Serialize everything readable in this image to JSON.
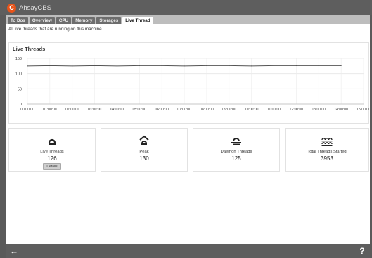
{
  "app": {
    "title": "AhsayCBS",
    "logo_letter": "C"
  },
  "tabs": [
    {
      "label": "To Dos",
      "active": false
    },
    {
      "label": "Overview",
      "active": false
    },
    {
      "label": "CPU",
      "active": false
    },
    {
      "label": "Memory",
      "active": false
    },
    {
      "label": "Storages",
      "active": false
    },
    {
      "label": "Live Thread",
      "active": true
    }
  ],
  "description": "All live threads that are running on this machine.",
  "chart_data": {
    "type": "line",
    "title": "Live Threads",
    "x": [
      "00:00:00",
      "01:00:00",
      "02:00:00",
      "03:00:00",
      "04:00:00",
      "05:00:00",
      "06:00:00",
      "07:00:00",
      "08:00:00",
      "09:00:00",
      "10:00:00",
      "11:00:00",
      "12:00:00",
      "13:00:00",
      "14:00:00",
      "15:00:00"
    ],
    "series": [
      {
        "values": [
          125,
          126,
          125,
          126,
          125,
          126,
          126,
          125,
          126,
          126,
          125,
          126,
          126,
          126,
          126
        ]
      }
    ],
    "ylim": [
      0,
      150
    ],
    "yticks": [
      0,
      50,
      100,
      150
    ],
    "xlim": [
      "00:00:00",
      "15:00:00"
    ],
    "grid": true,
    "line_color": "#555555"
  },
  "stats": [
    {
      "label": "Live Threads",
      "value": "126",
      "button": "Details",
      "icon": "live-threads-icon"
    },
    {
      "label": "Peak",
      "value": "130",
      "icon": "peak-icon"
    },
    {
      "label": "Daemon Threads",
      "value": "125",
      "icon": "daemon-threads-icon"
    },
    {
      "label": "Total Threads Started",
      "value": "3953",
      "icon": "total-threads-icon"
    }
  ],
  "bottom": {
    "back": "←",
    "help": "?"
  }
}
